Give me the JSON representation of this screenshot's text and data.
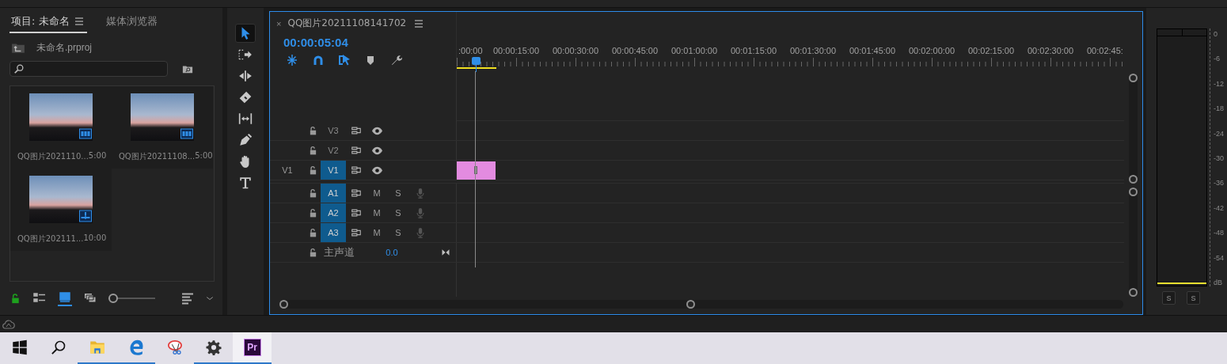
{
  "project_panel": {
    "tabs": [
      {
        "label": "项目: 未命名",
        "selected": true
      },
      {
        "label": "媒体浏览器",
        "selected": false
      }
    ],
    "file": "未命名.prproj",
    "items": [
      {
        "name": "QQ图片2021110...",
        "duration": "5:00",
        "kind": "video"
      },
      {
        "name": "QQ图片20211108...",
        "duration": "5:00",
        "kind": "video"
      },
      {
        "name": "QQ图片202111...",
        "duration": "10:00",
        "kind": "sequence"
      }
    ],
    "writable": true,
    "views": [
      {
        "kind": "list",
        "selected": false
      },
      {
        "kind": "icon",
        "selected": true
      },
      {
        "kind": "freeform",
        "selected": false
      }
    ],
    "zoom": {
      "level": 0
    }
  },
  "tools": [
    {
      "kind": "select",
      "selected": true
    },
    {
      "kind": "track-select",
      "selected": false
    },
    {
      "kind": "ripple",
      "selected": false
    },
    {
      "kind": "razor",
      "selected": false
    },
    {
      "kind": "slip",
      "selected": false
    },
    {
      "kind": "pen",
      "selected": false
    },
    {
      "kind": "hand",
      "selected": false
    },
    {
      "kind": "type",
      "selected": false
    }
  ],
  "timeline": {
    "close": "×",
    "title": "QQ图片20211108141702",
    "timecode": "00:00:05:04",
    "controls": [
      {
        "kind": "nest",
        "on": true
      },
      {
        "kind": "snap",
        "on": true
      },
      {
        "kind": "linked",
        "on": true
      },
      {
        "kind": "marker",
        "on": false
      },
      {
        "kind": "settings",
        "on": false
      }
    ],
    "ruler": [
      ":00:00",
      "00:00:15:00",
      "00:00:30:00",
      "00:00:45:00",
      "00:01:00:00",
      "00:01:15:00",
      "00:01:30:00",
      "00:01:45:00",
      "00:02:00:00",
      "00:02:15:00",
      "00:02:30:00",
      "00:02:45:"
    ],
    "tracks": [
      {
        "kind": "video",
        "name": "V3",
        "targeted": false,
        "clip": false
      },
      {
        "kind": "video",
        "name": "V2",
        "targeted": false,
        "clip": false
      },
      {
        "kind": "video",
        "name": "V1",
        "source": "V1",
        "targeted": true,
        "clip": true
      },
      {
        "kind": "audio",
        "name": "A1",
        "targeted": true,
        "mute": "M",
        "solo": "S"
      },
      {
        "kind": "audio",
        "name": "A2",
        "targeted": true,
        "mute": "M",
        "solo": "S"
      },
      {
        "kind": "audio",
        "name": "A3",
        "targeted": true,
        "mute": "M",
        "solo": "S"
      },
      {
        "kind": "master",
        "name": "主声道",
        "volume": "0.0"
      }
    ]
  },
  "audio_meter": {
    "scale": [
      "0",
      "-6",
      "-12",
      "-18",
      "-24",
      "-30",
      "-36",
      "-42",
      "-48",
      "-54",
      "dB"
    ],
    "solo_buttons": [
      "S",
      "S"
    ]
  },
  "taskbar": [
    {
      "kind": "start",
      "running": false,
      "active": false
    },
    {
      "kind": "search",
      "running": false,
      "active": false
    },
    {
      "kind": "explorer",
      "running": true,
      "active": false
    },
    {
      "kind": "edge",
      "running": true,
      "active": false
    },
    {
      "kind": "snip",
      "running": false,
      "active": false
    },
    {
      "kind": "settings",
      "running": true,
      "active": false
    },
    {
      "kind": "premiere",
      "label": "Pr",
      "running": true,
      "active": true
    }
  ]
}
